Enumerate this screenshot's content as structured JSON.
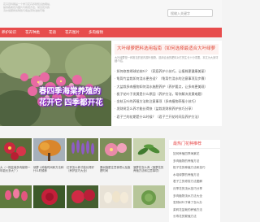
{
  "header": {
    "intro_lines": [
      "花卉百科网是一个学习花卉养殖知识的网站，",
      "提供各类花卉图片与栽培方法，常见花卉的",
      "浇水施肥修剪繁殖与病虫害防治技巧等"
    ],
    "search_placeholder": "搜输入关键字"
  },
  "nav": {
    "items": [
      "养护知识",
      "花卉种类",
      "花语",
      "花卉图片",
      "多肉植物"
    ]
  },
  "hero": {
    "caption": "春四季海棠养殖的花开它 四季都开花"
  },
  "feature": {
    "title": "大叶绿萝肥料选用指南（如何选择最适合大叶绿萝",
    "summary": "大叶绿萝是一种常见的室内观叶植物，选用合适的肥料对它的生长十分重要，本文为大家详细介绍。",
    "articles": [
      "· 如何修剪绣球花枝叶？（家庭养护小技巧，让植株更健康美丽）",
      "· 龟背竹盆栽如何浇水更合适？（龟背竹浇水的注意事项及步骤）",
      "· 大盆栽多肉植物如何浇水施肥养护（养护要点，让多肉更美观）",
      "· 栀子花叶子发黄是什么原因（养护方法，帮你解决发黄难题）",
      "· 金枝玉叶的养殖方法和注意事项（多肉植物养殖小技巧）",
      "· 发财树怎么养才能长得快（盆栽发财树养护技巧分享）",
      "· 君子兰的花期是什么时候？（君子兰开花时间及养护方法）"
    ]
  },
  "grid": {
    "items": [
      {
        "caption": "大（一株盆栽多肉植物一年能长多大？）",
        "palette": "red-flower"
      },
      {
        "caption": "胡萝卜种植时间和方法种什么时候种",
        "palette": "autumn-tree"
      },
      {
        "caption": "红掌怎么养才能长得好（养护技巧大全）",
        "palette": "purple-lavender"
      },
      {
        "caption": "果树施肥注意事项以及施肥时间",
        "palette": "pink-flower"
      },
      {
        "caption": "菠萝花怎么养（菠萝花的养殖方法和注意事项）",
        "palette": "green-plant"
      },
      {
        "caption": "",
        "palette": "pink-tulip"
      },
      {
        "caption": "",
        "palette": "red-rose"
      },
      {
        "caption": "",
        "palette": "red-rose"
      },
      {
        "caption": "",
        "palette": "eggs"
      },
      {
        "caption": "",
        "palette": "green-succulent"
      }
    ]
  },
  "sidebar": {
    "title": "最热门花种推荐",
    "items": [
      "如何养殖四季海棠花",
      "多肉植物的养殖方法",
      "栀子花的种植方法和技巧",
      "水培绿萝的养殖方法",
      "君子兰的修剪方法图解",
      "月季花的浇水技巧分享",
      "多肉植物浇水方法大全",
      "发财树叶子黄了怎么办",
      "茉莉花盆栽的养殖方法",
      "长寿花的繁殖方法"
    ]
  }
}
